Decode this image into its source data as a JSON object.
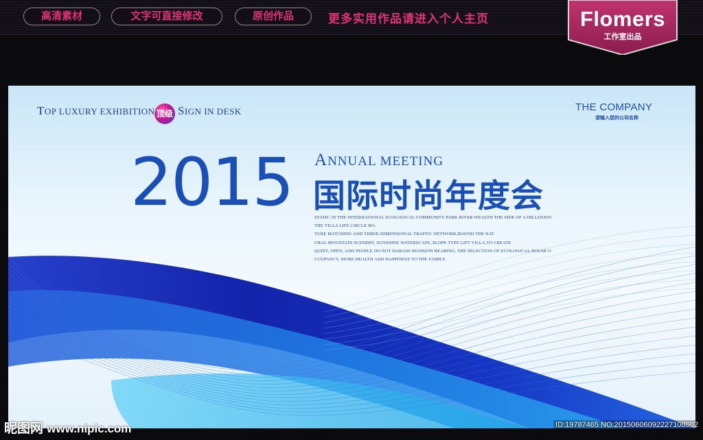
{
  "promo_bar": {
    "pills": [
      "高清素材",
      "文字可直接修改",
      "原创作品"
    ],
    "promo_text": "更多实用作品请进入个人主页",
    "brand_name": "Flomers",
    "brand_sub": "工作室出品",
    "colors": {
      "pill_text": "#e0347a",
      "brand_bg": "#a3235e"
    }
  },
  "banner": {
    "topline_left": {
      "cap": "T",
      "rest": "op luxury exhibition"
    },
    "badge": "顶级",
    "topline_right": {
      "cap": "S",
      "rest": "ign in desk"
    },
    "company": "THE COMPANY",
    "company_sub": "请输入您的公司名称",
    "year": "2015",
    "annual": {
      "cap": "A",
      "rest": "nnual meeting"
    },
    "title_cn": "国际时尚年度会",
    "description_lines": [
      "STATIC AT THE INTERNATIONAL ECOLOGICAL COMMUNITY PARK RIVER WEALTH THE SIDE OF A HILLENJOY",
      "THE VILLA LIFE CIRCLE MA",
      "TURE MATCHING AND THREE-DIMENSIONAL TRAFFIC NETWORK,ROUND THE NAT",
      "URAL MOUNTAIN SCENERY, SUNSHINE WATERSCAPE, SLOPE TYPE LIFT VILLA,TO CREATE",
      "QUIET, OPEN, AND PEOPLE DO NOT HARASS MANSION BEARING, THE SELECTION OF ECOLOGICAL HOUSE O",
      "CCUPANCY, MORE HEALTH AND HAPPINESS TO THE FAMILY."
    ],
    "colors": {
      "primary_blue": "#1a4fb8",
      "wave_deep": "#0a1fb0",
      "wave_light": "#2aa8e8"
    }
  },
  "watermark": {
    "site_cn": "昵图网",
    "site_url": "www.nipic.com",
    "id_text": "ID:19787465 NO:20150606092227108602"
  }
}
